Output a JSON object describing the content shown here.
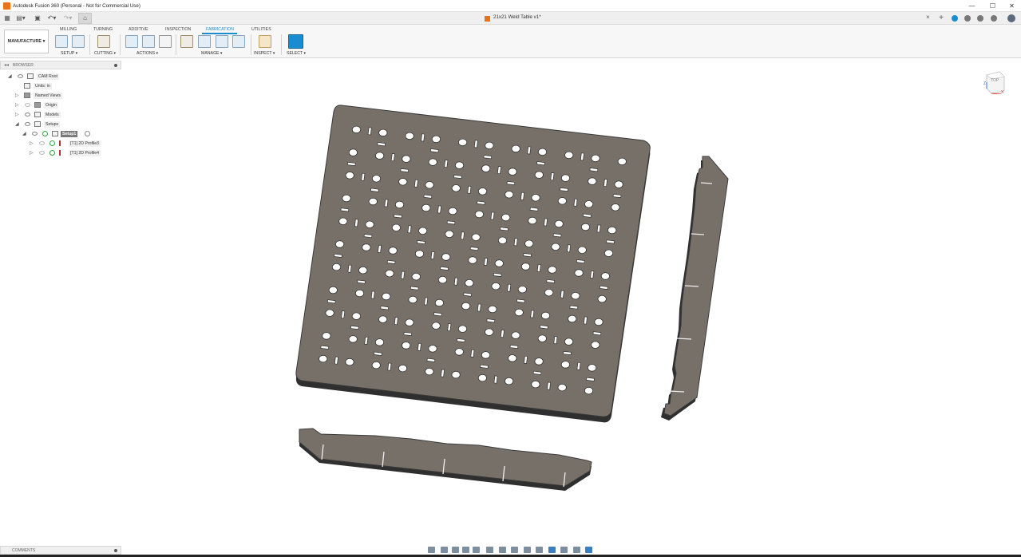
{
  "window": {
    "title": "Autodesk Fusion 360 (Personal - Not for Commercial Use)",
    "minimize": "—",
    "maximize": "☐",
    "close": "✕"
  },
  "document": {
    "tab_title": "21x21 Weld Table v1*",
    "close": "×"
  },
  "ribbon": {
    "workspace": "MANUFACTURE ▾",
    "tabs": [
      "MILLING",
      "TURNING",
      "ADDITIVE",
      "INSPECTION",
      "FABRICATION",
      "UTILITIES"
    ],
    "active_tab": "FABRICATION",
    "groups": {
      "setup": "SETUP ▾",
      "cutting": "CUTTING ▾",
      "actions": "ACTIONS ▾",
      "manage": "MANAGE ▾",
      "inspect": "INSPECT ▾",
      "select": "SELECT ▾"
    }
  },
  "browser": {
    "title": "BROWSER",
    "nodes": {
      "cam_root": "CAM Root",
      "units": "Units: in",
      "named_views": "Named Views",
      "origin": "Origin",
      "models": "Models",
      "setups": "Setups",
      "setup1": "Setup1",
      "profile3": "[T1] 2D Profile3",
      "profile4": "[T1] 2D Profile4"
    }
  },
  "viewcube": {
    "face": "TOP",
    "axis_x": "X",
    "axis_z": "Z"
  },
  "comments": {
    "title": "COMMENTS"
  },
  "colors": {
    "accent": "#1a8ccf",
    "part_fill": "#777068",
    "part_edge": "#2f2f2f",
    "app_orange": "#e8731c"
  }
}
